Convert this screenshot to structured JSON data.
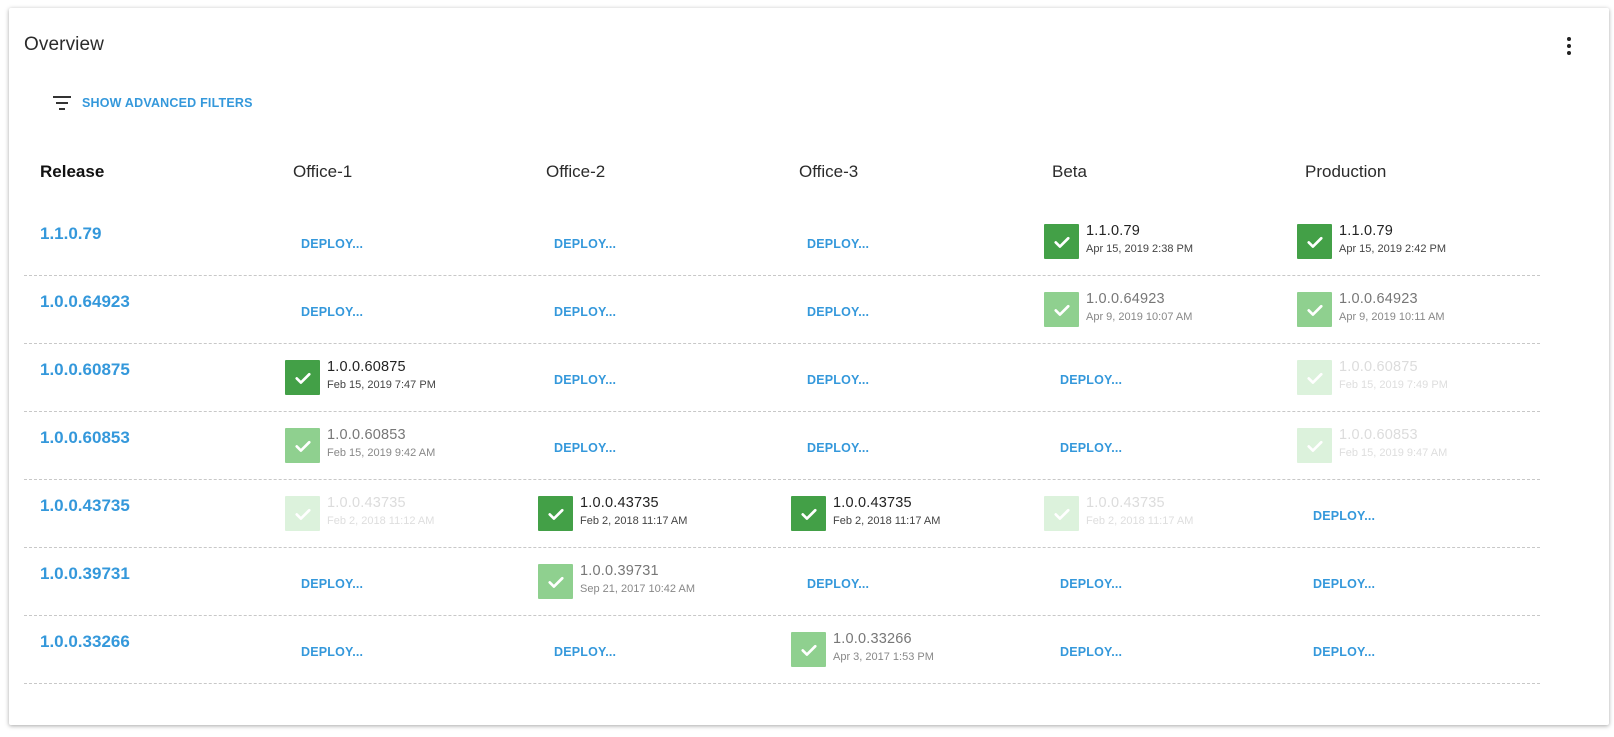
{
  "title": "Overview",
  "menu_icon": "more-vertical-icon",
  "filters": {
    "icon": "filter-icon",
    "label": "SHOW ADVANCED FILTERS"
  },
  "columns": [
    "Release",
    "Office-1",
    "Office-2",
    "Office-3",
    "Beta",
    "Production"
  ],
  "deploy_label": "DEPLOY...",
  "colors": {
    "accent": "#3498db",
    "current": "#43a047",
    "previous": "#8fd08f",
    "older": "#dcf2dc"
  },
  "releases": [
    {
      "version": "1.1.0.79",
      "cells": [
        {
          "deployed": false
        },
        {
          "deployed": false
        },
        {
          "deployed": false
        },
        {
          "deployed": true,
          "version": "1.1.0.79",
          "date": "Apr 15, 2019 2:38 PM",
          "level": 0
        },
        {
          "deployed": true,
          "version": "1.1.0.79",
          "date": "Apr 15, 2019 2:42 PM",
          "level": 0
        }
      ]
    },
    {
      "version": "1.0.0.64923",
      "cells": [
        {
          "deployed": false
        },
        {
          "deployed": false
        },
        {
          "deployed": false
        },
        {
          "deployed": true,
          "version": "1.0.0.64923",
          "date": "Apr 9, 2019 10:07 AM",
          "level": 1
        },
        {
          "deployed": true,
          "version": "1.0.0.64923",
          "date": "Apr 9, 2019 10:11 AM",
          "level": 1
        }
      ]
    },
    {
      "version": "1.0.0.60875",
      "cells": [
        {
          "deployed": true,
          "version": "1.0.0.60875",
          "date": "Feb 15, 2019 7:47 PM",
          "level": 0
        },
        {
          "deployed": false
        },
        {
          "deployed": false
        },
        {
          "deployed": false
        },
        {
          "deployed": true,
          "version": "1.0.0.60875",
          "date": "Feb 15, 2019 7:49 PM",
          "level": 2
        }
      ]
    },
    {
      "version": "1.0.0.60853",
      "cells": [
        {
          "deployed": true,
          "version": "1.0.0.60853",
          "date": "Feb 15, 2019 9:42 AM",
          "level": 1
        },
        {
          "deployed": false
        },
        {
          "deployed": false
        },
        {
          "deployed": false
        },
        {
          "deployed": true,
          "version": "1.0.0.60853",
          "date": "Feb 15, 2019 9:47 AM",
          "level": 2
        }
      ]
    },
    {
      "version": "1.0.0.43735",
      "cells": [
        {
          "deployed": true,
          "version": "1.0.0.43735",
          "date": "Feb 2, 2018 11:12 AM",
          "level": 2
        },
        {
          "deployed": true,
          "version": "1.0.0.43735",
          "date": "Feb 2, 2018 11:17 AM",
          "level": 0
        },
        {
          "deployed": true,
          "version": "1.0.0.43735",
          "date": "Feb 2, 2018 11:17 AM",
          "level": 0
        },
        {
          "deployed": true,
          "version": "1.0.0.43735",
          "date": "Feb 2, 2018 11:17 AM",
          "level": 2
        },
        {
          "deployed": false
        }
      ]
    },
    {
      "version": "1.0.0.39731",
      "cells": [
        {
          "deployed": false
        },
        {
          "deployed": true,
          "version": "1.0.0.39731",
          "date": "Sep 21, 2017 10:42 AM",
          "level": 1
        },
        {
          "deployed": false
        },
        {
          "deployed": false
        },
        {
          "deployed": false
        }
      ]
    },
    {
      "version": "1.0.0.33266",
      "cells": [
        {
          "deployed": false
        },
        {
          "deployed": false
        },
        {
          "deployed": true,
          "version": "1.0.0.33266",
          "date": "Apr 3, 2017 1:53 PM",
          "level": 1
        },
        {
          "deployed": false
        },
        {
          "deployed": false
        }
      ]
    }
  ]
}
